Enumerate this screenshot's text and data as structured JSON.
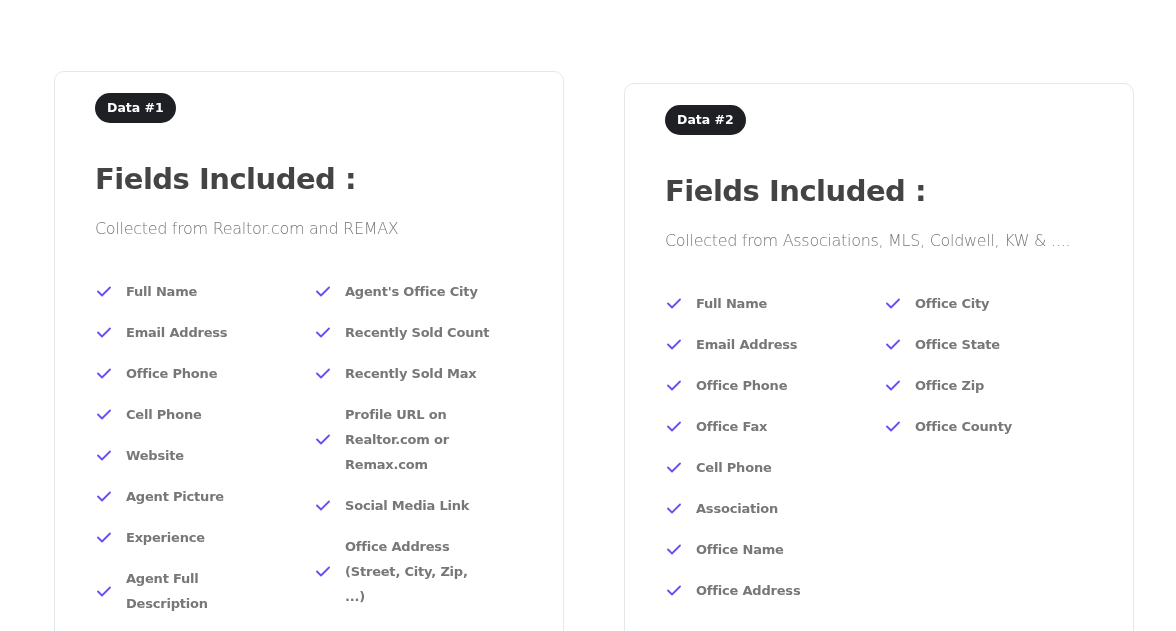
{
  "cards": [
    {
      "badge": "Data #1",
      "title": "Fields Included :",
      "subtitle": "Collected from Realtor.com and REMAX",
      "columns": [
        [
          "Full Name",
          "Email Address",
          "Office Phone",
          "Cell Phone",
          "Website",
          "Agent Picture",
          "Experience",
          "Agent Full Description"
        ],
        [
          "Agent's Office City",
          "Recently Sold Count",
          "Recently Sold Max",
          "Profile URL on Realtor.com or Remax.com",
          "Social Media Link",
          "Office Address (Street, City, Zip, ...)"
        ]
      ]
    },
    {
      "badge": "Data #2",
      "title": "Fields Included :",
      "subtitle": "Collected from Associations, MLS, Coldwell, KW & ....",
      "columns": [
        [
          "Full Name",
          "Email Address",
          "Office Phone",
          "Office Fax",
          "Cell Phone",
          "Association",
          "Office Name",
          "Office Address"
        ],
        [
          "Office City",
          "Office State",
          "Office Zip",
          "Office County"
        ]
      ]
    }
  ]
}
